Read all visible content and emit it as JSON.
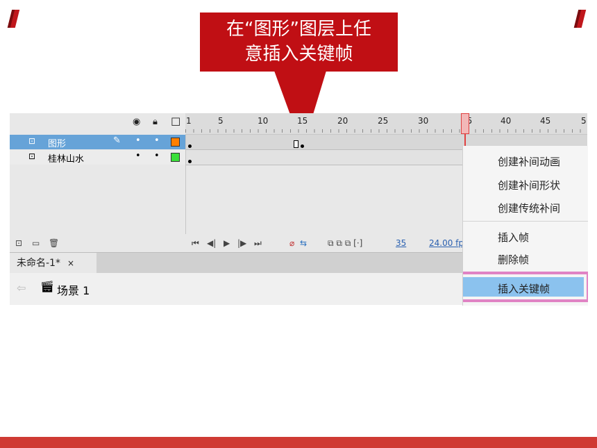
{
  "callout": {
    "line1": "在“图形”图层上任",
    "line2": "意插入关键帧"
  },
  "timeline": {
    "ruler_labels": [
      "1",
      "5",
      "10",
      "15",
      "20",
      "25",
      "30",
      "35",
      "40",
      "45",
      "5"
    ],
    "playhead_frame": "35",
    "layers": [
      {
        "name": "图形",
        "selected": true,
        "color": "#ff7f00"
      },
      {
        "name": "桂林山水",
        "selected": false,
        "color": "#3adf3a"
      }
    ],
    "current_frame": "35",
    "frame_rate": "24.00 fp"
  },
  "tab": {
    "label": "未命名-1*",
    "close": "×"
  },
  "scene": {
    "label": "场景 1"
  },
  "context_menu": {
    "items": [
      "创建补间动画",
      "创建补间形状",
      "创建传统补间",
      "插入帧",
      "删除帧",
      "插入关键帧"
    ],
    "highlighted": "插入关键帧"
  },
  "colors": {
    "accent_red": "#c00f14",
    "selection_blue": "#66a3d8",
    "highlight_pink": "#e083c4"
  }
}
